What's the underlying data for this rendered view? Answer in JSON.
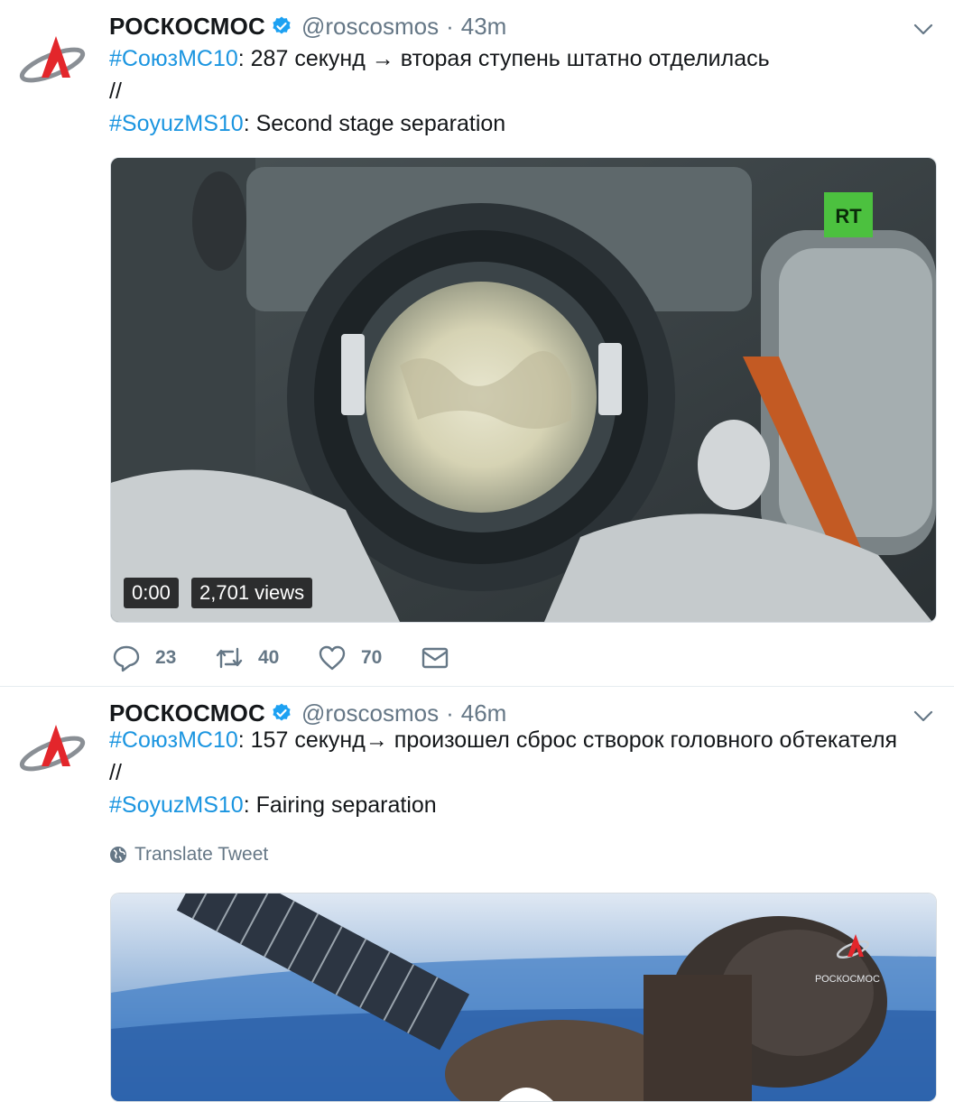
{
  "tweets": [
    {
      "author": "РОСКОСМОС",
      "handle": "@roscosmos",
      "separator": "·",
      "time": "43m",
      "text_line1_tag": "#СоюзМС10",
      "text_line1_rest": ":  287 секунд → вторая ступень штатно отделилась",
      "text_line2": "//",
      "text_line3_tag": "#SoyuzMS10",
      "text_line3_rest": ": Second stage separation",
      "video": {
        "overlay_logo": "RT",
        "time": "0:00",
        "views": "2,701 views"
      },
      "actions": {
        "replies": "23",
        "retweets": "40",
        "likes": "70"
      }
    },
    {
      "author": "РОСКОСМОС",
      "handle": "@roscosmos",
      "separator": "·",
      "time": "46m",
      "text_line1_tag": "#СоюзМС10",
      "text_line1_rest": ": 157 секунд→ произошел сброс створок головного обтекателя",
      "text_line2": "//",
      "text_line3_tag": "#SoyuzMS10",
      "text_line3_rest": ": Fairing separation",
      "translate_label": "Translate Tweet",
      "video": {
        "overlay_logo": "РОСКОСМОС"
      }
    }
  ],
  "colors": {
    "link": "#1b95e0",
    "secondary": "#657786",
    "logo_red": "#e3262b",
    "logo_gray": "#8a8f95"
  },
  "icons": [
    "roscosmos-logo-icon",
    "verified-badge-icon",
    "chevron-down-icon",
    "reply-icon",
    "retweet-icon",
    "like-icon",
    "dm-icon",
    "globe-icon"
  ]
}
